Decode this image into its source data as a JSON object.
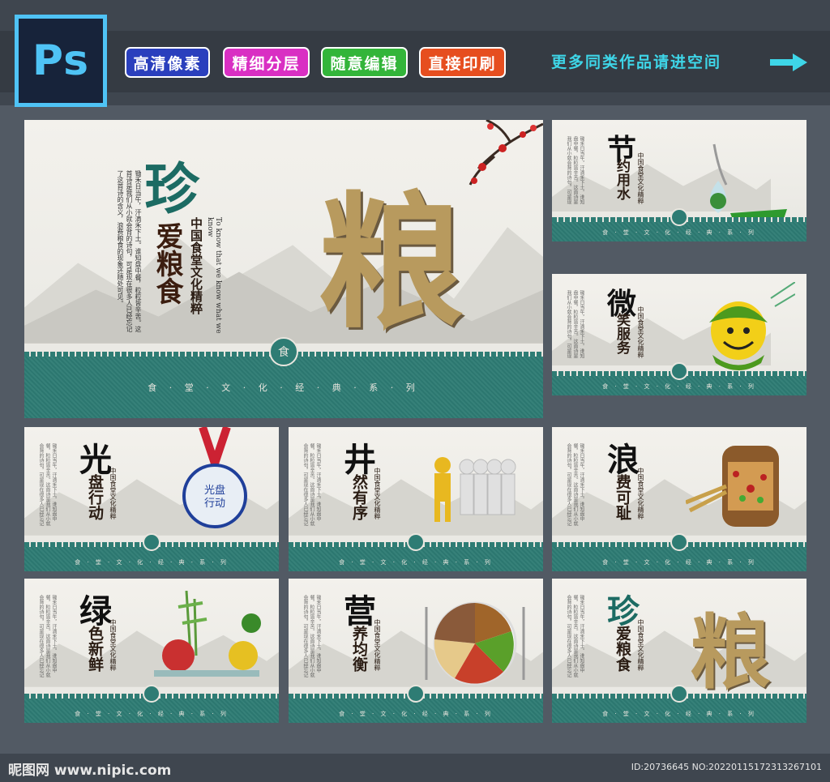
{
  "header": {
    "logo": "Ps",
    "tags": [
      {
        "label": "高清像素",
        "color": "#2a3fbd"
      },
      {
        "label": "精细分层",
        "color": "#d92fc3"
      },
      {
        "label": "随意编辑",
        "color": "#33b53a"
      },
      {
        "label": "直接印刷",
        "color": "#e64e1f"
      }
    ],
    "more": "更多同类作品请进空间",
    "more_color": "#3ed6e8"
  },
  "main_panel": {
    "big_char": "粮",
    "title_char": "珍",
    "title_rest": "爱粮食",
    "subtitle": "中国食堂文化精粹",
    "english": "To know that we know what we know",
    "seal": "食",
    "series": "食 · 堂 · 文 · 化 · 经 · 典 · 系 · 列",
    "poem": "锄禾日当午，汗滴禾下土。谁知盘中餐，粒粒皆辛苦。这首诗是我们从小就会背的诗句，可是现在很多人已经忘记了这首诗的含义，浪费粮食的现象还随处可见。"
  },
  "panels": [
    {
      "big": "节",
      "rest": "约用水",
      "sub": "中国食堂文化精粹"
    },
    {
      "big": "微",
      "rest": "笑服务",
      "sub": "中国食堂文化精粹"
    },
    {
      "big": "光",
      "rest": "盘行动",
      "sub": "中国食堂文化精粹",
      "medal": "光盘行动"
    },
    {
      "big": "井",
      "rest": "然有序",
      "sub": "中国食堂文化精粹"
    },
    {
      "big": "浪",
      "rest": "费可耻",
      "sub": "中国食堂文化精粹"
    },
    {
      "big": "绿",
      "rest": "色新鲜",
      "sub": "中国食堂文化精粹"
    },
    {
      "big": "营",
      "rest": "养均衡",
      "sub": "中国食堂文化精粹"
    },
    {
      "big": "珍",
      "rest": "爱粮食",
      "sub": "中国食堂文化精粹",
      "extra": "粮"
    }
  ],
  "small_series": "食 · 堂 · 文 · 化 · 经 · 典 · 系 · 列",
  "footer": {
    "site": "昵图网 www.nipic.com",
    "id": "ID:20736645 NO:20220115172313267101"
  }
}
